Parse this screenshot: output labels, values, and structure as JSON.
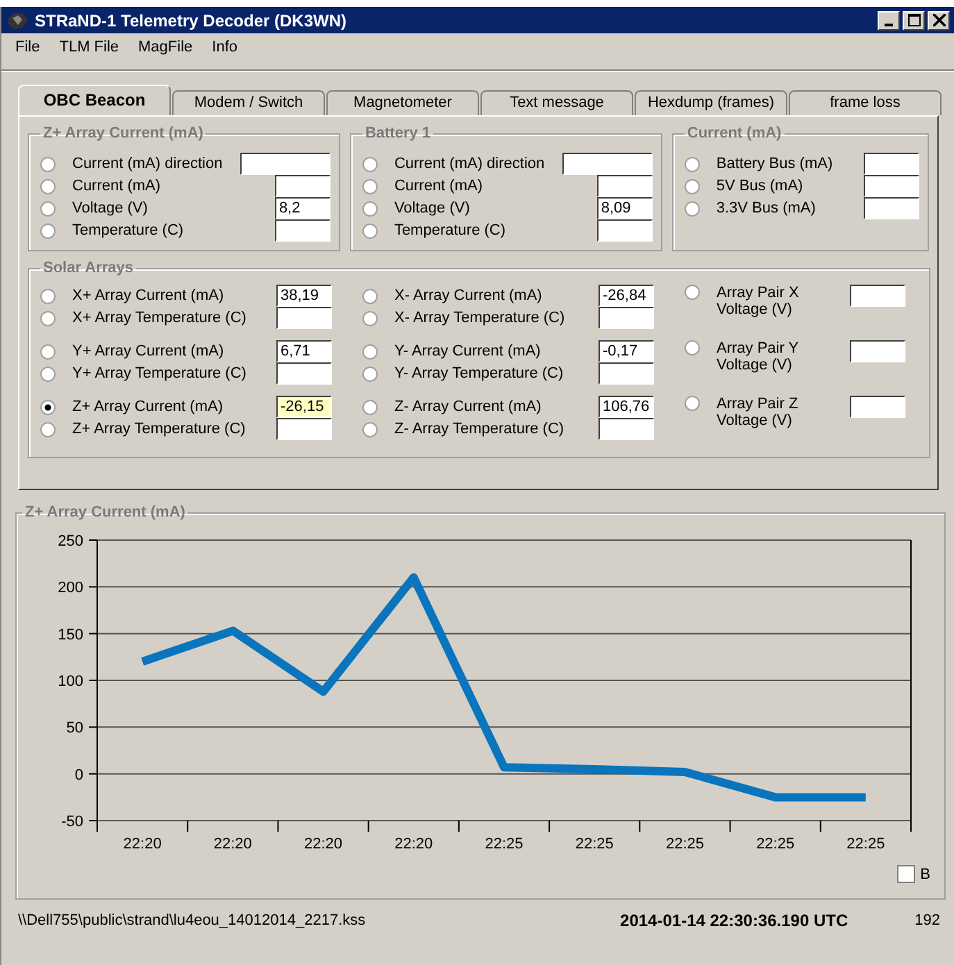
{
  "window": {
    "title": "STRaND-1 Telemetry Decoder (DK3WN)"
  },
  "menu": [
    "File",
    "TLM File",
    "MagFile",
    "Info"
  ],
  "tabs": [
    {
      "label": "OBC Beacon",
      "selected": true
    },
    {
      "label": "Modem / Switch",
      "selected": false
    },
    {
      "label": "Magnetometer",
      "selected": false
    },
    {
      "label": "Text message",
      "selected": false
    },
    {
      "label": "Hexdump (frames)",
      "selected": false
    },
    {
      "label": "frame loss",
      "selected": false
    }
  ],
  "top_groups": [
    {
      "title": "Z+ Array Current (mA)",
      "rows": [
        {
          "label": "Current (mA) direction",
          "kind": "wide",
          "selected": false
        },
        {
          "label": "Current (mA)",
          "kind": "normal",
          "selected": false
        },
        {
          "label": "Voltage (V)",
          "kind": "normal",
          "value": "8,2",
          "selected": false
        },
        {
          "label": "Temperature (C)",
          "kind": "normal",
          "selected": false
        }
      ]
    },
    {
      "title": "Battery 1",
      "rows": [
        {
          "label": "Current (mA) direction",
          "kind": "wide",
          "selected": false
        },
        {
          "label": "Current (mA)",
          "kind": "normal",
          "selected": false
        },
        {
          "label": "Voltage (V)",
          "kind": "normal",
          "value": "8,09",
          "selected": false
        },
        {
          "label": "Temperature (C)",
          "kind": "normal",
          "selected": false
        }
      ]
    },
    {
      "title": "Current (mA)",
      "rows": [
        {
          "label": "Battery Bus (mA)",
          "kind": "normal",
          "selected": false
        },
        {
          "label": "5V Bus (mA)",
          "kind": "normal",
          "selected": false
        },
        {
          "label": "3.3V Bus (mA)",
          "kind": "normal",
          "selected": false
        }
      ]
    }
  ],
  "solar_arrays": {
    "title": "Solar Arrays",
    "columns": [
      {
        "kind": "pairs",
        "groups": [
          [
            {
              "label": "X+ Array Current (mA)",
              "value": "38,19",
              "selected": false
            },
            {
              "label": "X+ Array Temperature (C)",
              "selected": false
            }
          ],
          [
            {
              "label": "Y+ Array Current (mA)",
              "value": "6,71",
              "selected": false
            },
            {
              "label": "Y+ Array Temperature (C)",
              "selected": false
            }
          ],
          [
            {
              "label": "Z+ Array Current (mA)",
              "value": "-26,15",
              "selected": true
            },
            {
              "label": "Z+ Array Temperature (C)",
              "selected": false
            }
          ]
        ]
      },
      {
        "kind": "pairs",
        "groups": [
          [
            {
              "label": "X- Array Current (mA)",
              "value": "-26,84",
              "selected": false
            },
            {
              "label": "X- Array Temperature (C)",
              "selected": false
            }
          ],
          [
            {
              "label": "Y- Array Current (mA)",
              "value": "-0,17",
              "selected": false
            },
            {
              "label": "Y- Array Temperature (C)",
              "selected": false
            }
          ],
          [
            {
              "label": "Z- Array Current (mA)",
              "value": "106,76",
              "selected": false
            },
            {
              "label": "Z- Array Temperature (C)",
              "selected": false
            }
          ]
        ]
      },
      {
        "kind": "single",
        "groups": [
          [
            {
              "label": "Array Pair X Voltage (V)",
              "selected": false
            }
          ],
          [
            {
              "label": "Array Pair Y Voltage (V)",
              "selected": false
            }
          ],
          [
            {
              "label": "Array Pair Z Voltage (V)",
              "selected": false
            }
          ]
        ]
      }
    ]
  },
  "chart_panel": {
    "chart_data": {
      "type": "line",
      "title": "Z+ Array Current (mA)",
      "grid": true,
      "categories": [
        "22:20",
        "22:20",
        "22:20",
        "22:20",
        "22:25",
        "22:25",
        "22:25",
        "22:25",
        "22:25"
      ],
      "series": [
        {
          "color": "#0a74bd",
          "values": [
            120,
            153,
            88,
            210,
            7,
            5,
            2,
            -25,
            -25
          ]
        }
      ],
      "ylim": [
        -50,
        250
      ],
      "yticks": [
        -50,
        0,
        50,
        100,
        150,
        200,
        250
      ]
    },
    "checkbox": {
      "label": "B",
      "checked": false
    }
  },
  "status_bar": {
    "path": "\\\\Dell755\\public\\strand\\lu4eou_14012014_2217.kss",
    "timestamp": "2014-01-14 22:30:36.190 UTC",
    "count": "192"
  }
}
